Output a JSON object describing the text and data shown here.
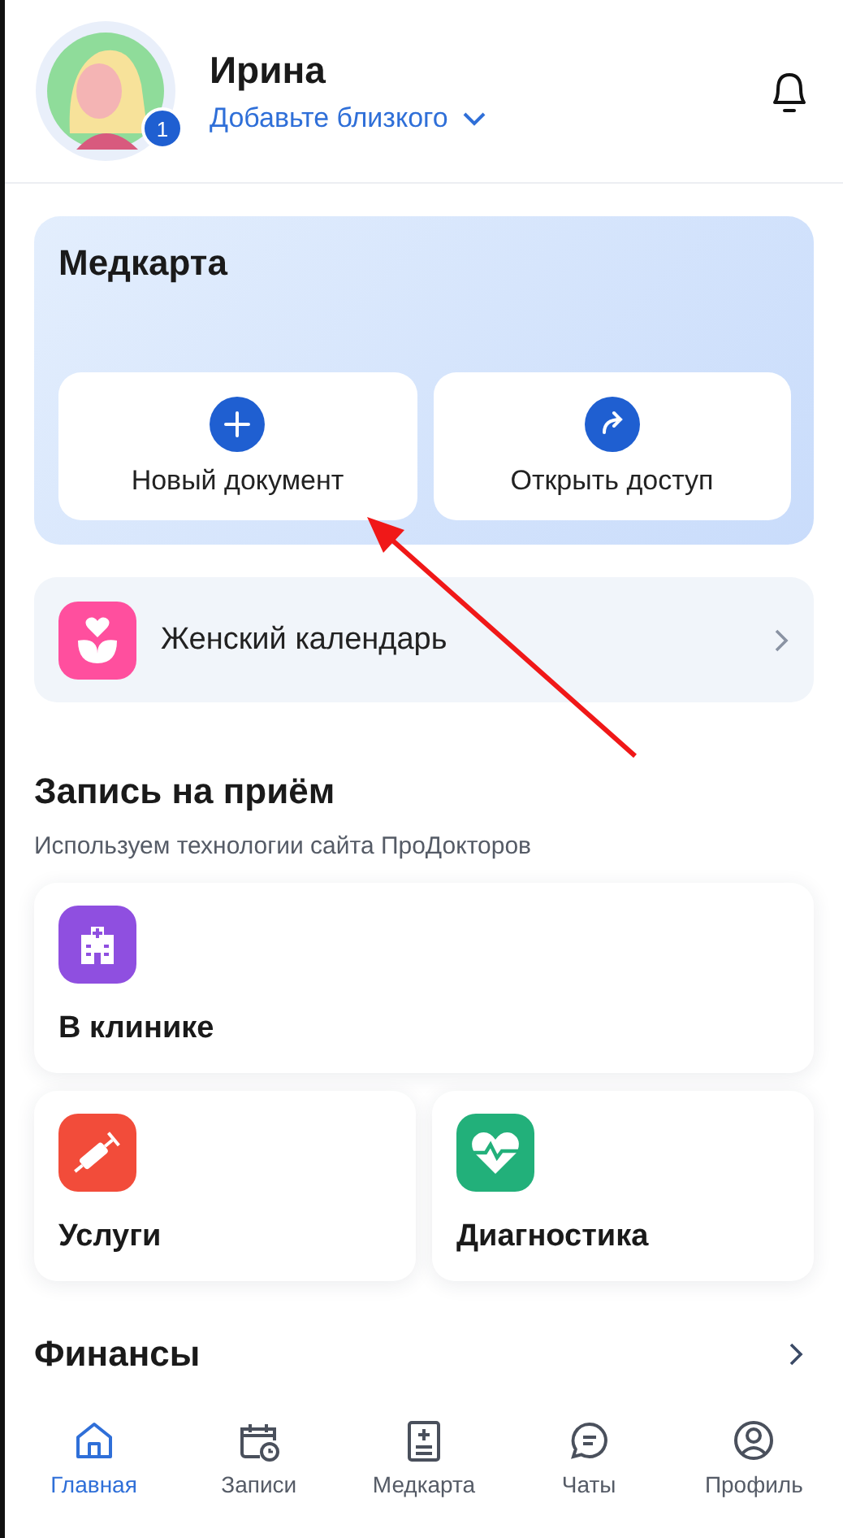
{
  "header": {
    "user_name": "Ирина",
    "badge": "1",
    "add_relative": "Добавьте близкого"
  },
  "medcard": {
    "title": "Медкарта",
    "actions": [
      {
        "label": "Новый документ",
        "kind": "plus"
      },
      {
        "label": "Открыть доступ",
        "kind": "share"
      }
    ]
  },
  "calendar_row": {
    "label": "Женский календарь"
  },
  "appointment": {
    "title": "Запись на приём",
    "subtitle": "Используем технологии сайта ПроДокторов",
    "cards": [
      {
        "label": "В клинике",
        "kind": "clinic",
        "color": "#8f4fe0"
      },
      {
        "label": "Услуги",
        "kind": "services",
        "color": "#f24c3a"
      },
      {
        "label": "Диагностика",
        "kind": "diagnostics",
        "color": "#22b07a"
      }
    ]
  },
  "finance": {
    "title": "Финансы"
  },
  "nav": [
    {
      "label": "Главная",
      "kind": "home",
      "selected": true
    },
    {
      "label": "Записи",
      "kind": "calendar",
      "selected": false
    },
    {
      "label": "Медкарта",
      "kind": "record",
      "selected": false
    },
    {
      "label": "Чаты",
      "kind": "chat",
      "selected": false
    },
    {
      "label": "Профиль",
      "kind": "profile",
      "selected": false
    }
  ]
}
